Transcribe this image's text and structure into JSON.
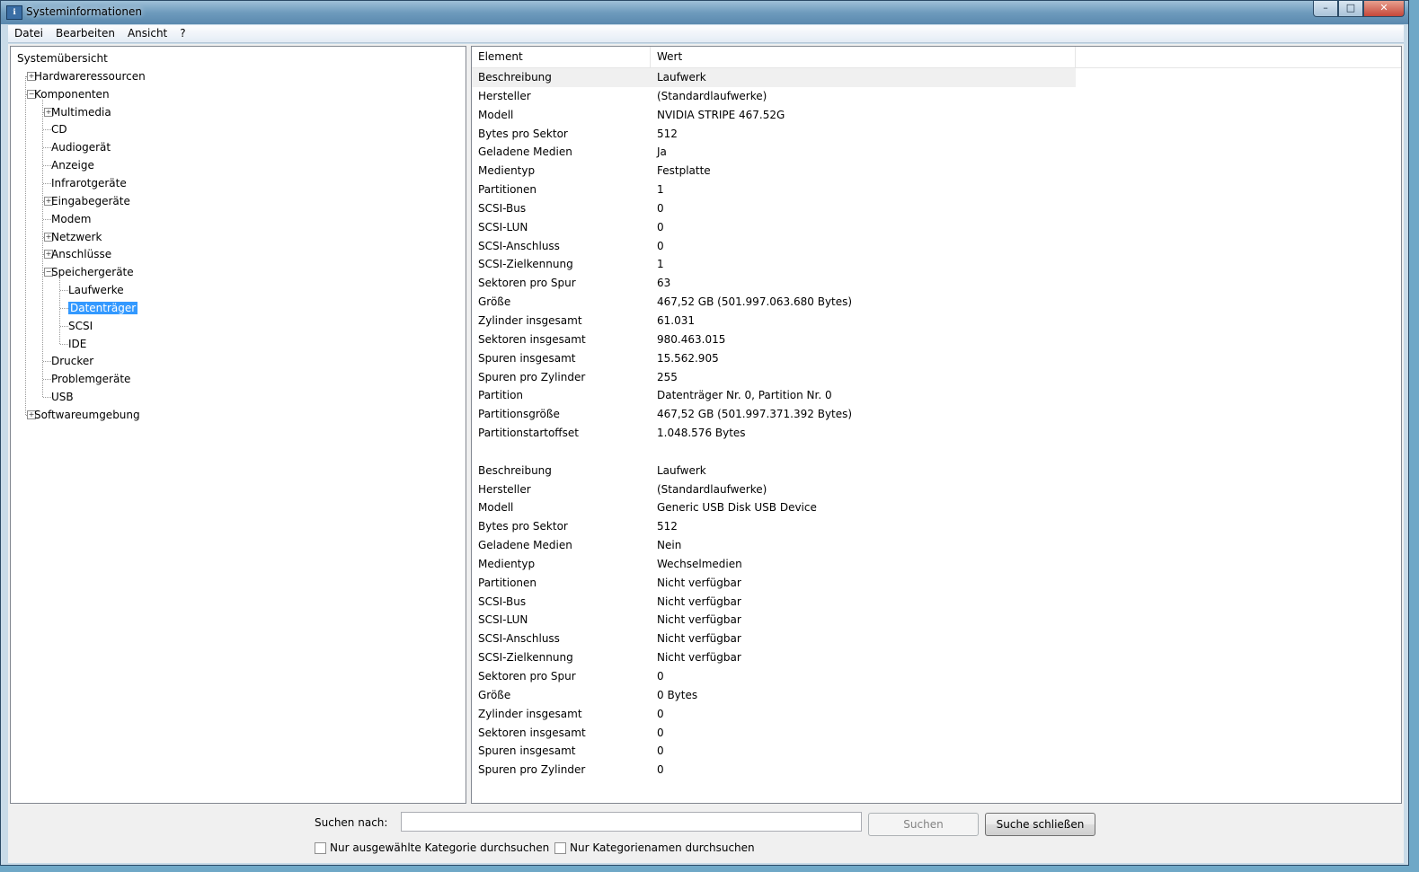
{
  "window": {
    "title": "Systeminformationen"
  },
  "menu": [
    "Datei",
    "Bearbeiten",
    "Ansicht",
    "?"
  ],
  "tree": [
    {
      "label": "Systemübersicht",
      "depth": 0,
      "expander": ""
    },
    {
      "label": "Hardwareressourcen",
      "depth": 1,
      "expander": "+"
    },
    {
      "label": "Komponenten",
      "depth": 1,
      "expander": "-"
    },
    {
      "label": "Multimedia",
      "depth": 2,
      "expander": "+"
    },
    {
      "label": "CD",
      "depth": 2,
      "expander": ""
    },
    {
      "label": "Audiogerät",
      "depth": 2,
      "expander": ""
    },
    {
      "label": "Anzeige",
      "depth": 2,
      "expander": ""
    },
    {
      "label": "Infrarotgeräte",
      "depth": 2,
      "expander": ""
    },
    {
      "label": "Eingabegeräte",
      "depth": 2,
      "expander": "+"
    },
    {
      "label": "Modem",
      "depth": 2,
      "expander": ""
    },
    {
      "label": "Netzwerk",
      "depth": 2,
      "expander": "+"
    },
    {
      "label": "Anschlüsse",
      "depth": 2,
      "expander": "+"
    },
    {
      "label": "Speichergeräte",
      "depth": 2,
      "expander": "-"
    },
    {
      "label": "Laufwerke",
      "depth": 3,
      "expander": ""
    },
    {
      "label": "Datenträger",
      "depth": 3,
      "expander": "",
      "selected": true
    },
    {
      "label": "SCSI",
      "depth": 3,
      "expander": ""
    },
    {
      "label": "IDE",
      "depth": 3,
      "expander": ""
    },
    {
      "label": "Drucker",
      "depth": 2,
      "expander": ""
    },
    {
      "label": "Problemgeräte",
      "depth": 2,
      "expander": ""
    },
    {
      "label": "USB",
      "depth": 2,
      "expander": ""
    },
    {
      "label": "Softwareumgebung",
      "depth": 1,
      "expander": "+"
    }
  ],
  "list": {
    "columns": [
      "Element",
      "Wert"
    ],
    "rows": [
      [
        "Beschreibung",
        "Laufwerk"
      ],
      [
        "Hersteller",
        "(Standardlaufwerke)"
      ],
      [
        "Modell",
        "NVIDIA  STRIPE   467.52G"
      ],
      [
        "Bytes pro Sektor",
        "512"
      ],
      [
        "Geladene Medien",
        "Ja"
      ],
      [
        "Medientyp",
        "Festplatte"
      ],
      [
        "Partitionen",
        "1"
      ],
      [
        "SCSI-Bus",
        "0"
      ],
      [
        "SCSI-LUN",
        "0"
      ],
      [
        "SCSI-Anschluss",
        "0"
      ],
      [
        "SCSI-Zielkennung",
        "1"
      ],
      [
        "Sektoren pro Spur",
        "63"
      ],
      [
        "Größe",
        "467,52 GB (501.997.063.680 Bytes)"
      ],
      [
        "Zylinder insgesamt",
        "61.031"
      ],
      [
        "Sektoren insgesamt",
        "980.463.015"
      ],
      [
        "Spuren insgesamt",
        "15.562.905"
      ],
      [
        "Spuren pro Zylinder",
        "255"
      ],
      [
        "Partition",
        "Datenträger Nr. 0, Partition Nr. 0"
      ],
      [
        "Partitionsgröße",
        "467,52 GB (501.997.371.392 Bytes)"
      ],
      [
        "Partitionstartoffset",
        "1.048.576 Bytes"
      ],
      [
        "",
        ""
      ],
      [
        "Beschreibung",
        "Laufwerk"
      ],
      [
        "Hersteller",
        "(Standardlaufwerke)"
      ],
      [
        "Modell",
        "Generic USB Disk USB Device"
      ],
      [
        "Bytes pro Sektor",
        "512"
      ],
      [
        "Geladene Medien",
        "Nein"
      ],
      [
        "Medientyp",
        "Wechselmedien"
      ],
      [
        "Partitionen",
        "Nicht verfügbar"
      ],
      [
        "SCSI-Bus",
        "Nicht verfügbar"
      ],
      [
        "SCSI-LUN",
        "Nicht verfügbar"
      ],
      [
        "SCSI-Anschluss",
        "Nicht verfügbar"
      ],
      [
        "SCSI-Zielkennung",
        "Nicht verfügbar"
      ],
      [
        "Sektoren pro Spur",
        "0"
      ],
      [
        "Größe",
        "0 Bytes"
      ],
      [
        "Zylinder insgesamt",
        "0"
      ],
      [
        "Sektoren insgesamt",
        "0"
      ],
      [
        "Spuren insgesamt",
        "0"
      ],
      [
        "Spuren pro Zylinder",
        "0"
      ]
    ]
  },
  "search": {
    "label": "Suchen nach:",
    "value": "",
    "search_button": "Suchen",
    "close_button": "Suche schließen",
    "check_selected": "Nur ausgewählte Kategorie durchsuchen",
    "check_names": "Nur Kategorienamen durchsuchen"
  }
}
